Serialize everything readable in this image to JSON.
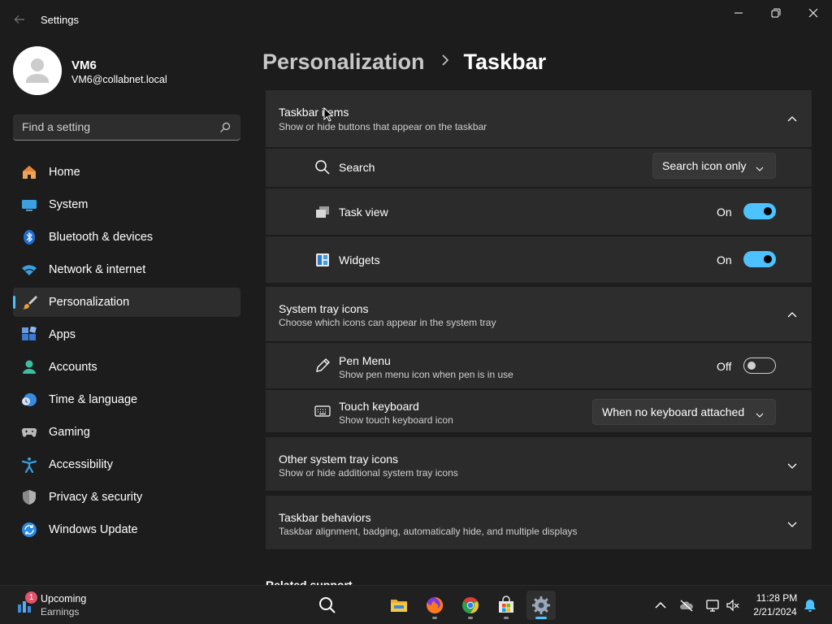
{
  "window": {
    "title": "Settings"
  },
  "profile": {
    "name": "VM6",
    "email": "VM6@collabnet.local"
  },
  "search": {
    "placeholder": "Find a setting"
  },
  "sidebar": {
    "items": [
      {
        "label": "Home",
        "icon": "home-icon"
      },
      {
        "label": "System",
        "icon": "system-icon"
      },
      {
        "label": "Bluetooth & devices",
        "icon": "bluetooth-icon"
      },
      {
        "label": "Network & internet",
        "icon": "wifi-icon"
      },
      {
        "label": "Personalization",
        "icon": "brush-icon",
        "active": true
      },
      {
        "label": "Apps",
        "icon": "apps-icon"
      },
      {
        "label": "Accounts",
        "icon": "person-icon"
      },
      {
        "label": "Time & language",
        "icon": "clock-globe-icon"
      },
      {
        "label": "Gaming",
        "icon": "gamepad-icon"
      },
      {
        "label": "Accessibility",
        "icon": "accessibility-icon"
      },
      {
        "label": "Privacy & security",
        "icon": "shield-icon"
      },
      {
        "label": "Windows Update",
        "icon": "update-icon"
      }
    ]
  },
  "breadcrumb": {
    "parent": "Personalization",
    "current": "Taskbar"
  },
  "sections": {
    "taskbar_items": {
      "title": "Taskbar items",
      "subtitle": "Show or hide buttons that appear on the taskbar",
      "rows": {
        "search": {
          "label": "Search",
          "value": "Search icon only"
        },
        "task_view": {
          "label": "Task view",
          "state": "On",
          "on": true
        },
        "widgets": {
          "label": "Widgets",
          "state": "On",
          "on": true
        }
      }
    },
    "system_tray": {
      "title": "System tray icons",
      "subtitle": "Choose which icons can appear in the system tray",
      "rows": {
        "pen_menu": {
          "label": "Pen Menu",
          "sub": "Show pen menu icon when pen is in use",
          "state": "Off",
          "on": false
        },
        "touch_keyboard": {
          "label": "Touch keyboard",
          "sub": "Show touch keyboard icon",
          "value": "When no keyboard attached"
        }
      }
    },
    "other_tray": {
      "title": "Other system tray icons",
      "subtitle": "Show or hide additional system tray icons"
    },
    "behaviors": {
      "title": "Taskbar behaviors",
      "subtitle": "Taskbar alignment, badging, automatically hide, and multiple displays"
    }
  },
  "related": {
    "label": "Related support"
  },
  "taskbar": {
    "weather": {
      "badge": "1",
      "title": "Upcoming",
      "subtitle": "Earnings"
    },
    "clock": {
      "time": "11:28 PM",
      "date": "2/21/2024"
    }
  },
  "colors": {
    "accent": "#4cc2ff",
    "background": "#1c1c1c",
    "card": "#2b2b2b"
  }
}
